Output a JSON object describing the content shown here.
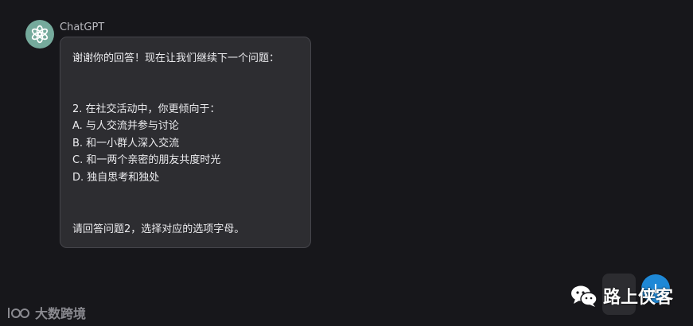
{
  "chat": {
    "sender": "ChatGPT",
    "lines": [
      "谢谢你的回答！现在让我们继续下一个问题：",
      "2. 在社交活动中，你更倾向于：",
      "A. 与人交流并参与讨论",
      "B. 和一小群人深入交流",
      "C. 和一两个亲密的朋友共度时光",
      "D. 独自思考和独处",
      "请回答问题2，选择对应的选项字母。"
    ]
  },
  "watermarks": {
    "left_text": "大数跨境",
    "right_text": "路上侠客"
  },
  "colors": {
    "background": "#17171b",
    "bubble": "#2d2d31",
    "avatar": "#75aa9c",
    "accent_blue": "#1e88d6"
  },
  "icons": {
    "avatar": "openai-logo-icon",
    "left_watermark": "100-logo-icon",
    "right_watermark": "wechat-icon"
  }
}
